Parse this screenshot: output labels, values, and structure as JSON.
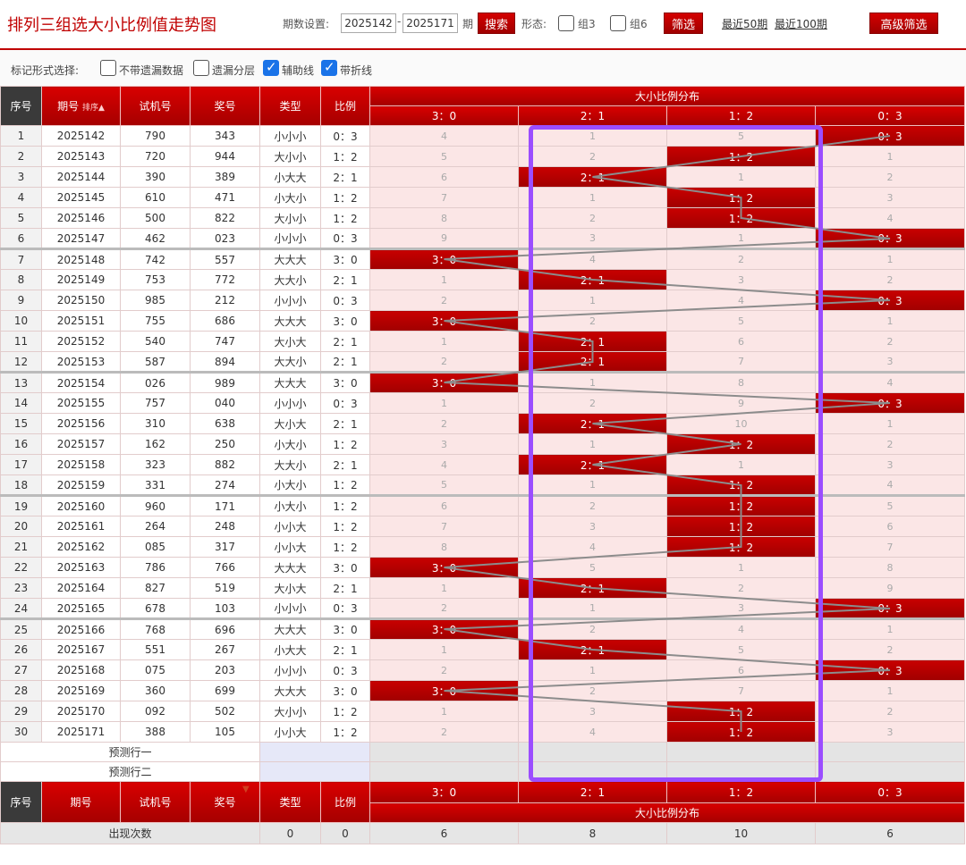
{
  "header": {
    "title": "排列三组选大小比例值走势图",
    "period_label": "期数设置:",
    "period_start": "2025142",
    "period_end": "2025171",
    "period_unit": "期",
    "search_label": "搜索",
    "shape_label": "形态:",
    "group3_label": "组3",
    "group6_label": "组6",
    "filter_label": "筛选",
    "recent50_label": "最近50期",
    "recent100_label": "最近100期",
    "advanced_label": "高级筛选"
  },
  "options": {
    "label": "标记形式选择:",
    "items": [
      {
        "label": "不带遗漏数据",
        "checked": false
      },
      {
        "label": "遗漏分层",
        "checked": false
      },
      {
        "label": "辅助线",
        "checked": true
      },
      {
        "label": "带折线",
        "checked": true
      }
    ]
  },
  "table": {
    "headers": {
      "seq": "序号",
      "issue": "期号",
      "sort": "排序",
      "trial": "试机号",
      "prize": "奖号",
      "type": "类型",
      "ratio": "比例",
      "dist_title": "大小比例分布",
      "dist_cols": [
        "3：0",
        "2：1",
        "1：2",
        "0：3"
      ]
    },
    "rows": [
      {
        "seq": "1",
        "issue": "2025142",
        "trial": "790",
        "prize": "343",
        "type": "小小小",
        "ratio": "0：3",
        "dist": [
          "4",
          "1",
          "5",
          "0：3"
        ],
        "hit": 3
      },
      {
        "seq": "2",
        "issue": "2025143",
        "trial": "720",
        "prize": "944",
        "type": "大小小",
        "ratio": "1：2",
        "dist": [
          "5",
          "2",
          "1：2",
          "1"
        ],
        "hit": 2
      },
      {
        "seq": "3",
        "issue": "2025144",
        "trial": "390",
        "prize": "389",
        "type": "小大大",
        "ratio": "2：1",
        "dist": [
          "6",
          "2：1",
          "1",
          "2"
        ],
        "hit": 1
      },
      {
        "seq": "4",
        "issue": "2025145",
        "trial": "610",
        "prize": "471",
        "type": "小大小",
        "ratio": "1：2",
        "dist": [
          "7",
          "1",
          "1：2",
          "3"
        ],
        "hit": 2
      },
      {
        "seq": "5",
        "issue": "2025146",
        "trial": "500",
        "prize": "822",
        "type": "大小小",
        "ratio": "1：2",
        "dist": [
          "8",
          "2",
          "1：2",
          "4"
        ],
        "hit": 2
      },
      {
        "seq": "6",
        "issue": "2025147",
        "trial": "462",
        "prize": "023",
        "type": "小小小",
        "ratio": "0：3",
        "dist": [
          "9",
          "3",
          "1",
          "0：3"
        ],
        "hit": 3
      },
      {
        "seq": "7",
        "issue": "2025148",
        "trial": "742",
        "prize": "557",
        "type": "大大大",
        "ratio": "3：0",
        "dist": [
          "3：0",
          "4",
          "2",
          "1"
        ],
        "hit": 0
      },
      {
        "seq": "8",
        "issue": "2025149",
        "trial": "753",
        "prize": "772",
        "type": "大大小",
        "ratio": "2：1",
        "dist": [
          "1",
          "2：1",
          "3",
          "2"
        ],
        "hit": 1
      },
      {
        "seq": "9",
        "issue": "2025150",
        "trial": "985",
        "prize": "212",
        "type": "小小小",
        "ratio": "0：3",
        "dist": [
          "2",
          "1",
          "4",
          "0：3"
        ],
        "hit": 3
      },
      {
        "seq": "10",
        "issue": "2025151",
        "trial": "755",
        "prize": "686",
        "type": "大大大",
        "ratio": "3：0",
        "dist": [
          "3：0",
          "2",
          "5",
          "1"
        ],
        "hit": 0
      },
      {
        "seq": "11",
        "issue": "2025152",
        "trial": "540",
        "prize": "747",
        "type": "大小大",
        "ratio": "2：1",
        "dist": [
          "1",
          "2：1",
          "6",
          "2"
        ],
        "hit": 1
      },
      {
        "seq": "12",
        "issue": "2025153",
        "trial": "587",
        "prize": "894",
        "type": "大大小",
        "ratio": "2：1",
        "dist": [
          "2",
          "2：1",
          "7",
          "3"
        ],
        "hit": 1
      },
      {
        "seq": "13",
        "issue": "2025154",
        "trial": "026",
        "prize": "989",
        "type": "大大大",
        "ratio": "3：0",
        "dist": [
          "3：0",
          "1",
          "8",
          "4"
        ],
        "hit": 0
      },
      {
        "seq": "14",
        "issue": "2025155",
        "trial": "757",
        "prize": "040",
        "type": "小小小",
        "ratio": "0：3",
        "dist": [
          "1",
          "2",
          "9",
          "0：3"
        ],
        "hit": 3
      },
      {
        "seq": "15",
        "issue": "2025156",
        "trial": "310",
        "prize": "638",
        "type": "大小大",
        "ratio": "2：1",
        "dist": [
          "2",
          "2：1",
          "10",
          "1"
        ],
        "hit": 1
      },
      {
        "seq": "16",
        "issue": "2025157",
        "trial": "162",
        "prize": "250",
        "type": "小大小",
        "ratio": "1：2",
        "dist": [
          "3",
          "1",
          "1：2",
          "2"
        ],
        "hit": 2
      },
      {
        "seq": "17",
        "issue": "2025158",
        "trial": "323",
        "prize": "882",
        "type": "大大小",
        "ratio": "2：1",
        "dist": [
          "4",
          "2：1",
          "1",
          "3"
        ],
        "hit": 1
      },
      {
        "seq": "18",
        "issue": "2025159",
        "trial": "331",
        "prize": "274",
        "type": "小大小",
        "ratio": "1：2",
        "dist": [
          "5",
          "1",
          "1：2",
          "4"
        ],
        "hit": 2
      },
      {
        "seq": "19",
        "issue": "2025160",
        "trial": "960",
        "prize": "171",
        "type": "小大小",
        "ratio": "1：2",
        "dist": [
          "6",
          "2",
          "1：2",
          "5"
        ],
        "hit": 2
      },
      {
        "seq": "20",
        "issue": "2025161",
        "trial": "264",
        "prize": "248",
        "type": "小小大",
        "ratio": "1：2",
        "dist": [
          "7",
          "3",
          "1：2",
          "6"
        ],
        "hit": 2
      },
      {
        "seq": "21",
        "issue": "2025162",
        "trial": "085",
        "prize": "317",
        "type": "小小大",
        "ratio": "1：2",
        "dist": [
          "8",
          "4",
          "1：2",
          "7"
        ],
        "hit": 2
      },
      {
        "seq": "22",
        "issue": "2025163",
        "trial": "786",
        "prize": "766",
        "type": "大大大",
        "ratio": "3：0",
        "dist": [
          "3：0",
          "5",
          "1",
          "8"
        ],
        "hit": 0
      },
      {
        "seq": "23",
        "issue": "2025164",
        "trial": "827",
        "prize": "519",
        "type": "大小大",
        "ratio": "2：1",
        "dist": [
          "1",
          "2：1",
          "2",
          "9"
        ],
        "hit": 1
      },
      {
        "seq": "24",
        "issue": "2025165",
        "trial": "678",
        "prize": "103",
        "type": "小小小",
        "ratio": "0：3",
        "dist": [
          "2",
          "1",
          "3",
          "0：3"
        ],
        "hit": 3
      },
      {
        "seq": "25",
        "issue": "2025166",
        "trial": "768",
        "prize": "696",
        "type": "大大大",
        "ratio": "3：0",
        "dist": [
          "3：0",
          "2",
          "4",
          "1"
        ],
        "hit": 0
      },
      {
        "seq": "26",
        "issue": "2025167",
        "trial": "551",
        "prize": "267",
        "type": "小大大",
        "ratio": "2：1",
        "dist": [
          "1",
          "2：1",
          "5",
          "2"
        ],
        "hit": 1
      },
      {
        "seq": "27",
        "issue": "2025168",
        "trial": "075",
        "prize": "203",
        "type": "小小小",
        "ratio": "0：3",
        "dist": [
          "2",
          "1",
          "6",
          "0：3"
        ],
        "hit": 3
      },
      {
        "seq": "28",
        "issue": "2025169",
        "trial": "360",
        "prize": "699",
        "type": "大大大",
        "ratio": "3：0",
        "dist": [
          "3：0",
          "2",
          "7",
          "1"
        ],
        "hit": 0
      },
      {
        "seq": "29",
        "issue": "2025170",
        "trial": "092",
        "prize": "502",
        "type": "大小小",
        "ratio": "1：2",
        "dist": [
          "1",
          "3",
          "1：2",
          "2"
        ],
        "hit": 2
      },
      {
        "seq": "30",
        "issue": "2025171",
        "trial": "388",
        "prize": "105",
        "type": "小小大",
        "ratio": "1：2",
        "dist": [
          "2",
          "4",
          "1：2",
          "3"
        ],
        "hit": 2
      }
    ],
    "predict": [
      "预测行一",
      "预测行二"
    ],
    "stats": {
      "label": "出现次数",
      "type_count": "0",
      "ratio_count": "0",
      "values": [
        "6",
        "8",
        "10",
        "6"
      ]
    }
  },
  "colors": {
    "accent": "#c00000",
    "hit_cell": "#b00000",
    "dist_bg": "#fbe6e6",
    "highlight": "#9b4dff",
    "checkbox": "#1a73e8"
  }
}
